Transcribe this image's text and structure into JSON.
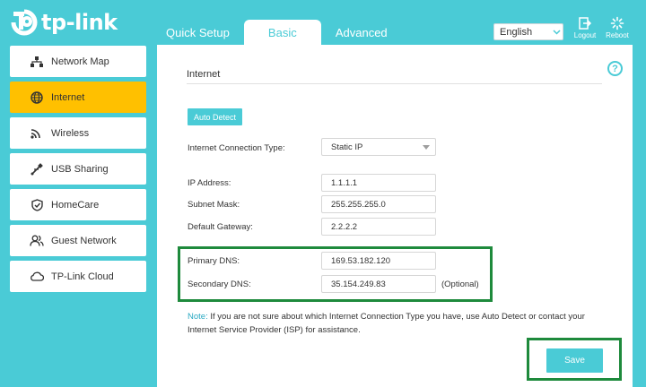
{
  "brand": {
    "name": "tp-link",
    "accent": "#4acbd6",
    "active_nav": "#ffc000",
    "highlight": "#1e8a3c"
  },
  "header": {
    "tabs": [
      {
        "label": "Quick Setup",
        "active": false
      },
      {
        "label": "Basic",
        "active": true
      },
      {
        "label": "Advanced",
        "active": false
      }
    ],
    "language": "English",
    "logout_label": "Logout",
    "reboot_label": "Reboot"
  },
  "sidebar": {
    "items": [
      {
        "label": "Network Map",
        "icon": "network-map-icon",
        "active": false
      },
      {
        "label": "Internet",
        "icon": "globe-icon",
        "active": true
      },
      {
        "label": "Wireless",
        "icon": "wifi-icon",
        "active": false
      },
      {
        "label": "USB Sharing",
        "icon": "usb-icon",
        "active": false
      },
      {
        "label": "HomeCare",
        "icon": "shield-icon",
        "active": false
      },
      {
        "label": "Guest Network",
        "icon": "guests-icon",
        "active": false
      },
      {
        "label": "TP-Link Cloud",
        "icon": "cloud-icon",
        "active": false
      }
    ]
  },
  "main": {
    "title": "Internet",
    "auto_detect_label": "Auto Detect",
    "connection_type": {
      "label": "Internet Connection Type:",
      "value": "Static IP"
    },
    "ip_address": {
      "label": "IP Address:",
      "value": "1.1.1.1"
    },
    "subnet_mask": {
      "label": "Subnet Mask:",
      "value": "255.255.255.0"
    },
    "default_gateway": {
      "label": "Default Gateway:",
      "value": "2.2.2.2"
    },
    "primary_dns": {
      "label": "Primary DNS:",
      "value": "169.53.182.120"
    },
    "secondary_dns": {
      "label": "Secondary DNS:",
      "value": "35.154.249.83",
      "optional": "(Optional)"
    },
    "note": {
      "label": "Note:",
      "text": "If you are not sure about which Internet Connection Type you have, use Auto Detect or contact your Internet Service Provider (ISP) for assistance."
    },
    "save_label": "Save"
  }
}
